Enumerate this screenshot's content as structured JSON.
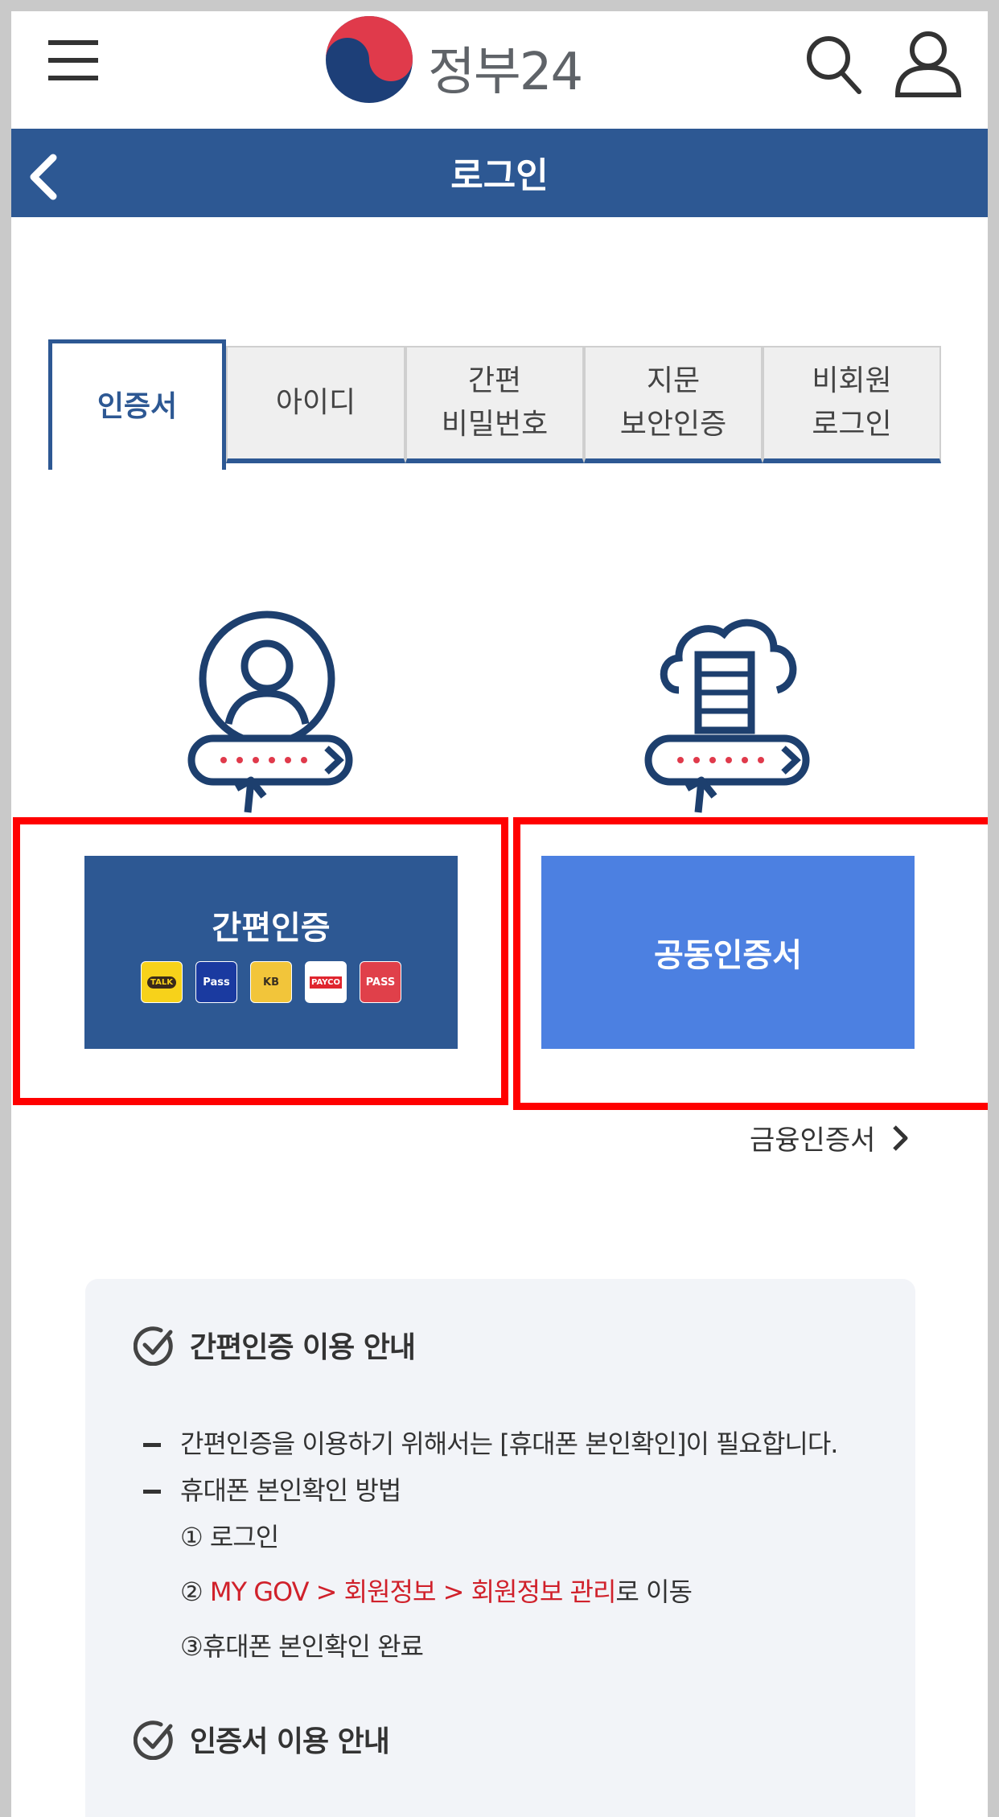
{
  "header": {
    "logo_text": "정부24",
    "title": "로그인"
  },
  "tabs": [
    {
      "label": "인증서",
      "active": true
    },
    {
      "label": "아이디",
      "active": false
    },
    {
      "label": "간편\n비밀번호",
      "active": false
    },
    {
      "label": "지문\n보안인증",
      "active": false
    },
    {
      "label": "비회원\n로그인",
      "active": false
    }
  ],
  "buttons": {
    "simple_auth": {
      "label": "간편인증",
      "badges": [
        "TALK",
        "Pass",
        "KB",
        "PAYCO",
        "PASS"
      ]
    },
    "joint_cert": {
      "label": "공동인증서"
    },
    "financial_cert": {
      "label": "금융인증서"
    }
  },
  "info": {
    "section1_title": "간편인증 이용 안내",
    "line1": "간편인증을 이용하기 위해서는 [휴대폰 본인확인]이 필요합니다.",
    "line2": "휴대폰 본인확인 방법",
    "step1": "① 로그인",
    "step2_prefix": "② ",
    "step2_red": "MY GOV > 회원정보 > 회원정보 관리",
    "step2_suffix": "로 이동",
    "step3": "③휴대폰 본인확인 완료",
    "section2_title": "인증서 이용 안내"
  },
  "colors": {
    "primary": "#2d5893",
    "joint_button": "#4c80e1",
    "highlight_outline": "#ff0000",
    "link_red": "#d0212b"
  }
}
